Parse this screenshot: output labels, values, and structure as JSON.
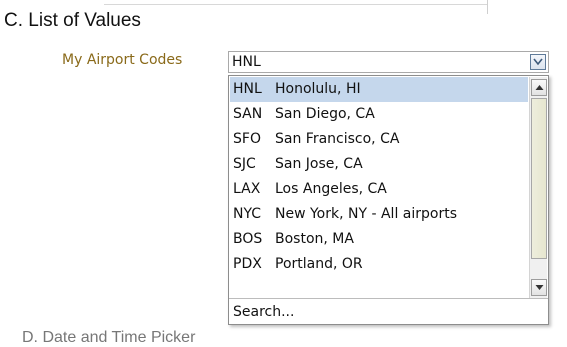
{
  "section": {
    "title": "C. List of Values"
  },
  "field": {
    "label": "My Airport Codes",
    "value": "HNL"
  },
  "dropdown": {
    "options": [
      {
        "code": "HNL",
        "name": "Honolulu, HI",
        "selected": true
      },
      {
        "code": "SAN",
        "name": "San Diego, CA",
        "selected": false
      },
      {
        "code": "SFO",
        "name": "San Francisco, CA",
        "selected": false
      },
      {
        "code": "SJC",
        "name": "San Jose, CA",
        "selected": false
      },
      {
        "code": "LAX",
        "name": "Los Angeles, CA",
        "selected": false
      },
      {
        "code": "NYC",
        "name": "New York, NY - All airports",
        "selected": false
      },
      {
        "code": "BOS",
        "name": "Boston, MA",
        "selected": false
      },
      {
        "code": "PDX",
        "name": "Portland, OR",
        "selected": false
      }
    ],
    "search_label": "Search..."
  },
  "next_section": {
    "title": "D. Date and Time Picker"
  },
  "icons": {
    "combo_button": "chevron-down-icon",
    "scroll_up": "arrow-up-icon",
    "scroll_down": "arrow-down-icon"
  },
  "colors": {
    "label": "#8a6a1a",
    "selection": "#c5d7ec",
    "scroll_thumb": "#e6e6cf"
  }
}
